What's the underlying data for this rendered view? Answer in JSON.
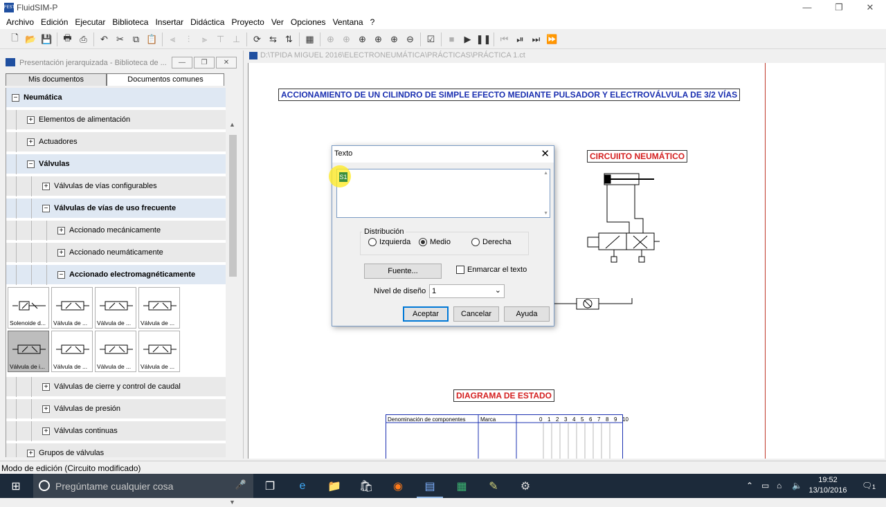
{
  "window": {
    "title": "FluidSIM-P",
    "app_icon": "FESTO",
    "min": "—",
    "max": "❐",
    "close": "✕"
  },
  "menu": [
    "Archivo",
    "Edición",
    "Ejecutar",
    "Biblioteca",
    "Insertar",
    "Didáctica",
    "Proyecto",
    "Ver",
    "Opciones",
    "Ventana",
    "?"
  ],
  "library": {
    "title": "Presentación jerarquizada - Biblioteca de ...",
    "tabs": [
      "Mis documentos",
      "Documentos comunes"
    ],
    "tree": [
      {
        "label": "Neumática",
        "level": 0,
        "exp": "−",
        "bold": true
      },
      {
        "label": "Elementos de alimentación",
        "level": 1,
        "exp": "+"
      },
      {
        "label": "Actuadores",
        "level": 1,
        "exp": "+"
      },
      {
        "label": "Válvulas",
        "level": 1,
        "exp": "−",
        "bold": true
      },
      {
        "label": "Válvulas de vías configurables",
        "level": 2,
        "exp": "+"
      },
      {
        "label": "Válvulas de vías de uso frecuente",
        "level": 2,
        "exp": "−",
        "bold": true
      },
      {
        "label": "Accionado mecánicamente",
        "level": 3,
        "exp": "+"
      },
      {
        "label": "Accionado neumáticamente",
        "level": 3,
        "exp": "+"
      },
      {
        "label": "Accionado electromagnéticamente",
        "level": 3,
        "exp": "−",
        "bold": true
      }
    ],
    "thumbs": [
      "Solenoide d...",
      "Válvula de ...",
      "Válvula de ...",
      "Válvula de ...",
      "Válvula de i...",
      "Válvula de ...",
      "Válvula de ...",
      "Válvula de ..."
    ],
    "tree2": [
      {
        "label": "Válvulas de cierre y control de caudal",
        "level": 2,
        "exp": "+"
      },
      {
        "label": "Válvulas de presión",
        "level": 2,
        "exp": "+"
      },
      {
        "label": "Válvulas continuas",
        "level": 2,
        "exp": "+"
      },
      {
        "label": "Grupos de válvulas",
        "level": 1,
        "exp": "+"
      }
    ]
  },
  "document": {
    "path": "D:\\TPIDA MIGUEL 2016\\ELECTRONEUMÁTICA\\PRÁCTICAS\\PRÁCTICA 1.ct",
    "heading": "ACCIONAMIENTO DE UN CILINDRO DE SIMPLE EFECTO MEDIANTE PULSADOR Y ELECTROVÁLVULA DE 3/2  VÍAS",
    "circuit_label": "CIRCUIITO  NEUMÁTICO",
    "state_label": "DIAGRAMA  DE  ESTADO",
    "table_headers": [
      "Denominación de componentes",
      "Marca"
    ],
    "table_steps": [
      "0",
      "1",
      "2",
      "3",
      "4",
      "5",
      "6",
      "7",
      "8",
      "9",
      "10"
    ]
  },
  "dialog": {
    "title": "Texto",
    "close": "✕",
    "text_value": "S1",
    "distribution_label": "Distribución",
    "options": [
      "Izquierda",
      "Medio",
      "Derecha"
    ],
    "selected": "Medio",
    "font_button": "Fuente...",
    "frame_label": "Enmarcar el texto",
    "level_label": "Nivel de diseño",
    "level_value": "1",
    "ok": "Aceptar",
    "cancel": "Cancelar",
    "help": "Ayuda"
  },
  "status": "Modo de edición (Circuito modificado)",
  "taskbar": {
    "search_placeholder": "Pregúntame cualquier cosa",
    "time": "19:52",
    "date": "13/10/2016",
    "notif": "1"
  }
}
